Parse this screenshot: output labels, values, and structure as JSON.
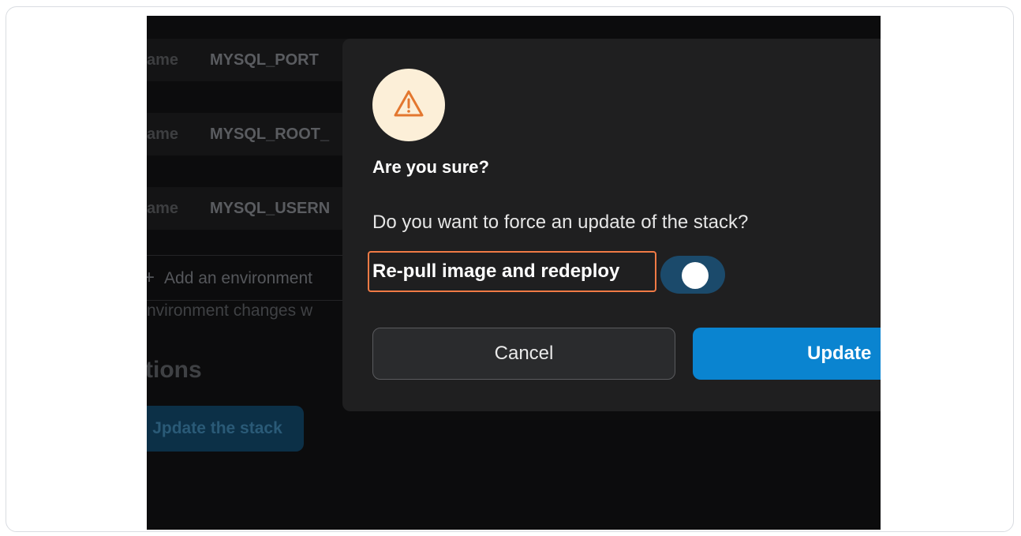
{
  "background": {
    "env_rows": [
      {
        "name_label": "ame",
        "value": "MYSQL_PORT"
      },
      {
        "name_label": "ame",
        "value": "MYSQL_ROOT_"
      },
      {
        "name_label": "ame",
        "value": "MYSQL_USERN"
      }
    ],
    "add_env_label": "Add an environment",
    "env_note": "nvironment changes w",
    "actions_heading": "tions",
    "update_stack_label": "Jpdate the stack"
  },
  "modal": {
    "icon": "warning-triangle-icon",
    "title": "Are you sure?",
    "question": "Do you want to force an update of the stack?",
    "toggle_label": "Re-pull image and redeploy",
    "toggle_on": true,
    "cancel_label": "Cancel",
    "update_label": "Update"
  },
  "colors": {
    "accent": "#0a84d0",
    "highlight": "#f07a45",
    "warning": "#e3772f"
  }
}
